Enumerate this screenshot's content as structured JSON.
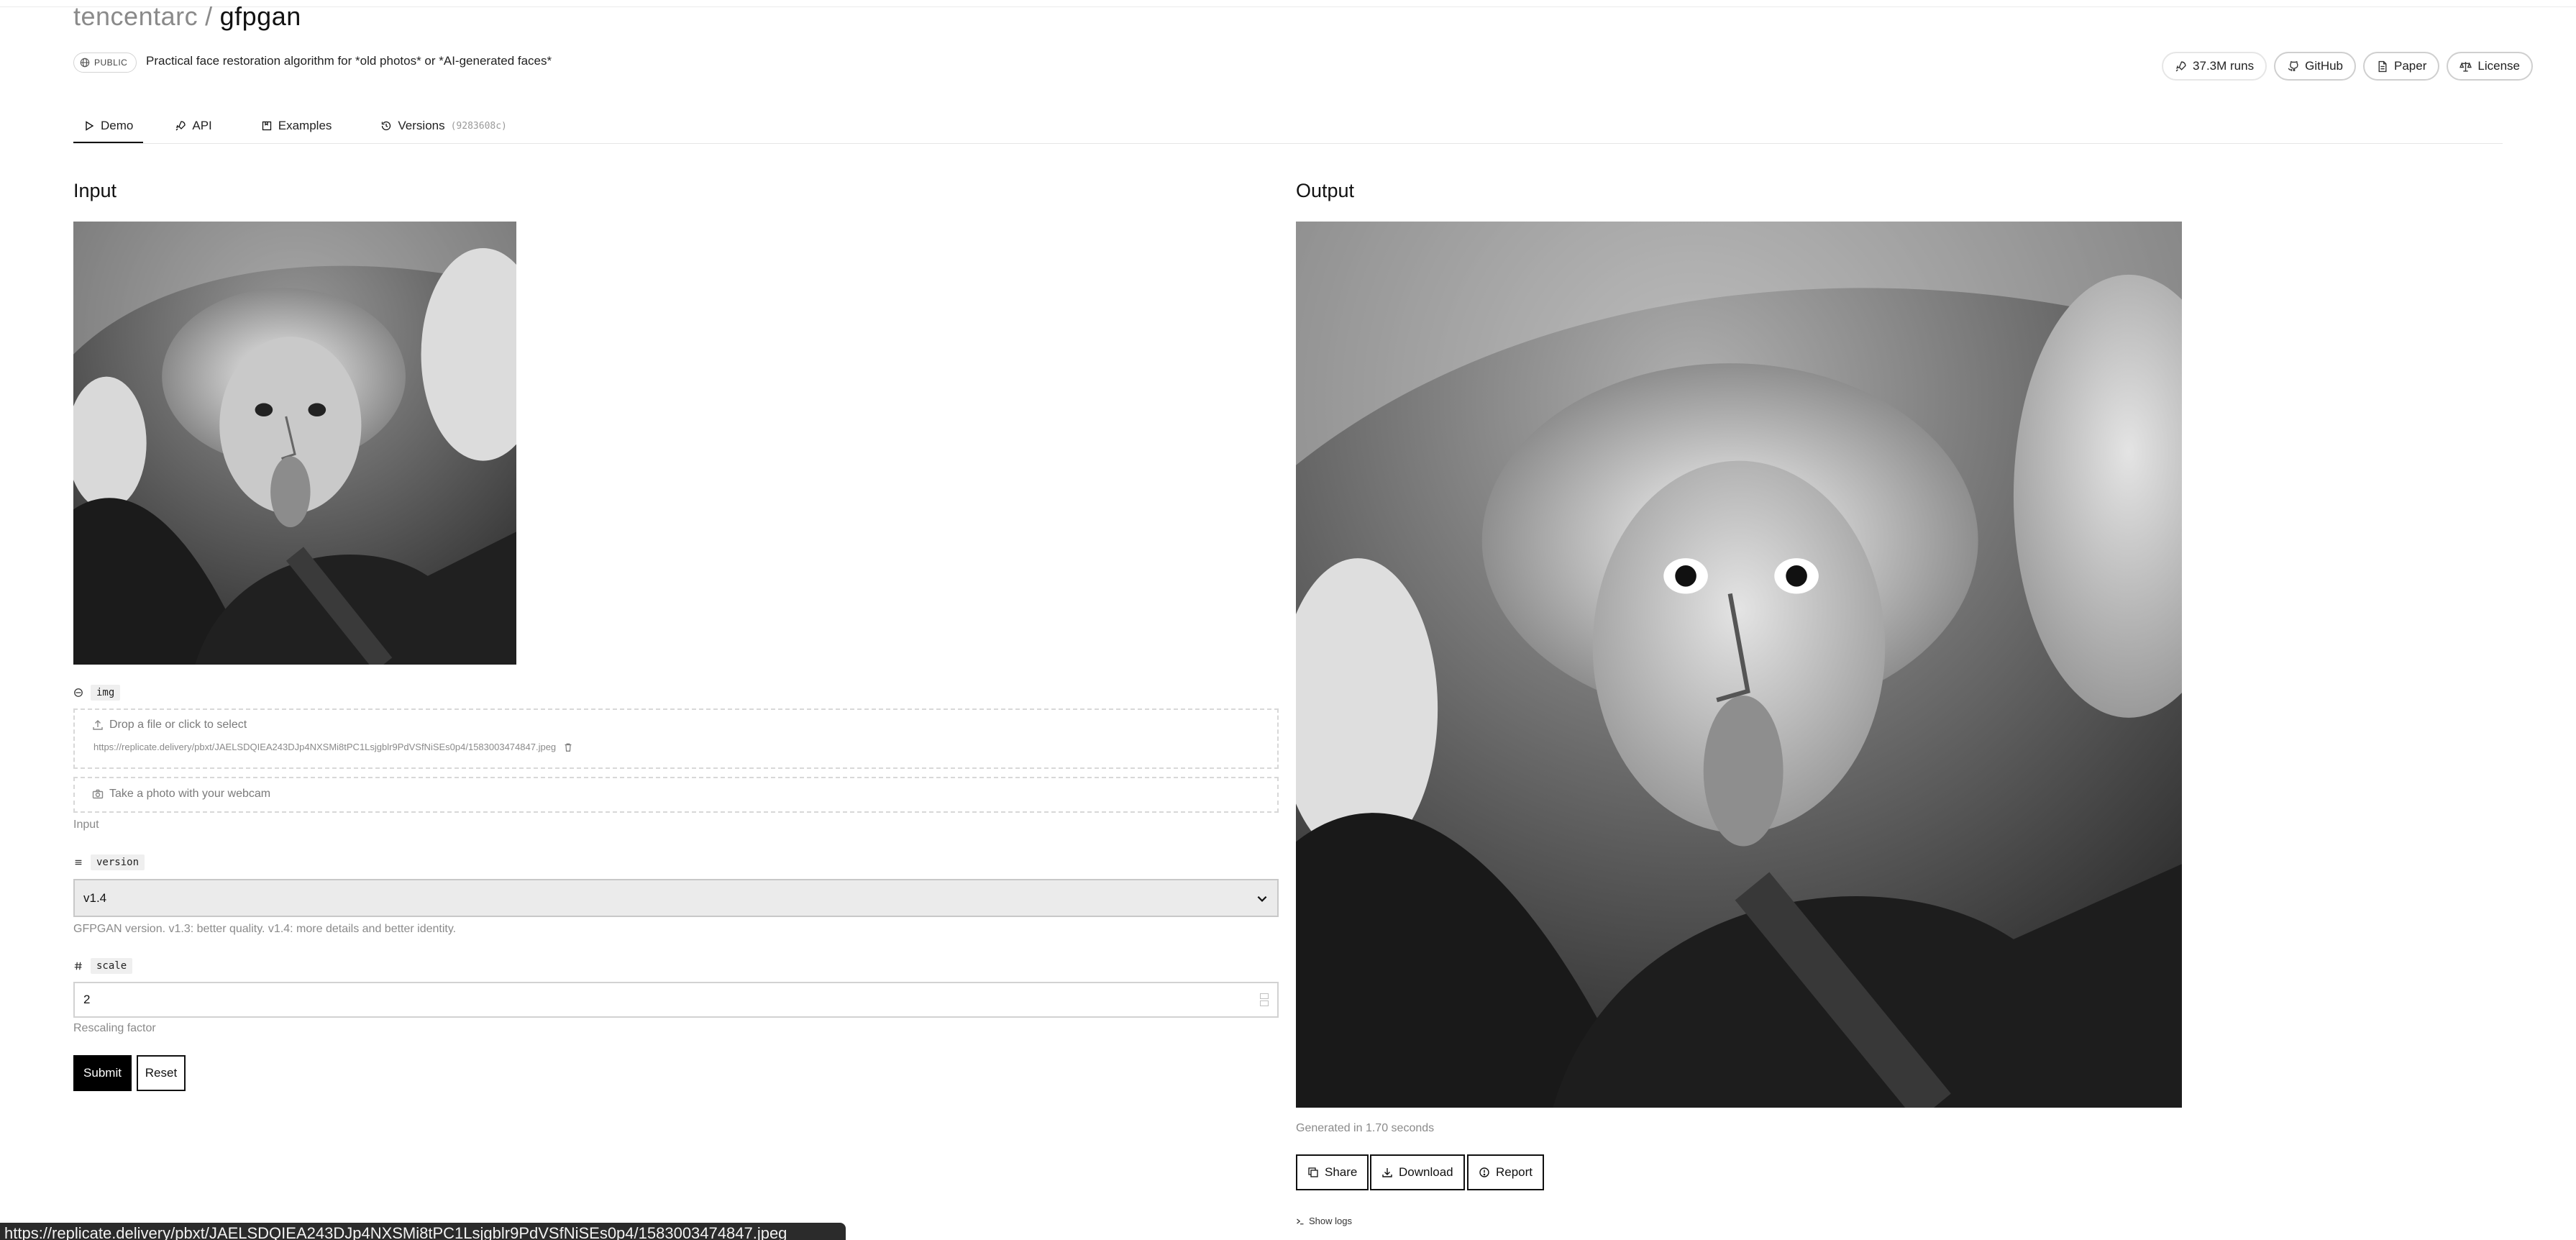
{
  "header": {
    "owner": "tencentarc",
    "separator": "/",
    "model_name": "gfpgan",
    "visibility_badge": "PUBLIC",
    "description": "Practical face restoration algorithm for *old photos* or *AI-generated faces*"
  },
  "stats": {
    "runs_label": "37.3M runs",
    "github_label": "GitHub",
    "paper_label": "Paper",
    "license_label": "License"
  },
  "tabs": {
    "demo": "Demo",
    "api": "API",
    "examples": "Examples",
    "versions": "Versions",
    "version_hash": "(9283608c)"
  },
  "input": {
    "title": "Input",
    "img": {
      "name": "img",
      "drop_text": "Drop a file or click to select",
      "file_url": "https://replicate.delivery/pbxt/JAELSDQIEA243DJp4NXSMi8tPC1Lsjgblr9PdVSfNiSEs0p4/1583003474847.jpeg",
      "webcam_text": "Take a photo with your webcam",
      "help": "Input"
    },
    "version": {
      "name": "version",
      "selected": "v1.4",
      "help": "GFPGAN version. v1.3: better quality. v1.4: more details and better identity."
    },
    "scale": {
      "name": "scale",
      "value": "2",
      "help": "Rescaling factor"
    },
    "submit_label": "Submit",
    "reset_label": "Reset"
  },
  "output": {
    "title": "Output",
    "generated_text": "Generated in 1.70 seconds",
    "share_label": "Share",
    "download_label": "Download",
    "report_label": "Report",
    "show_logs_label": "Show logs"
  },
  "statusbar": {
    "url": "https://replicate.delivery/pbxt/JAELSDQIEA243DJp4NXSMi8tPC1Lsjgblr9PdVSfNiSEs0p4/1583003474847.jpeg"
  }
}
